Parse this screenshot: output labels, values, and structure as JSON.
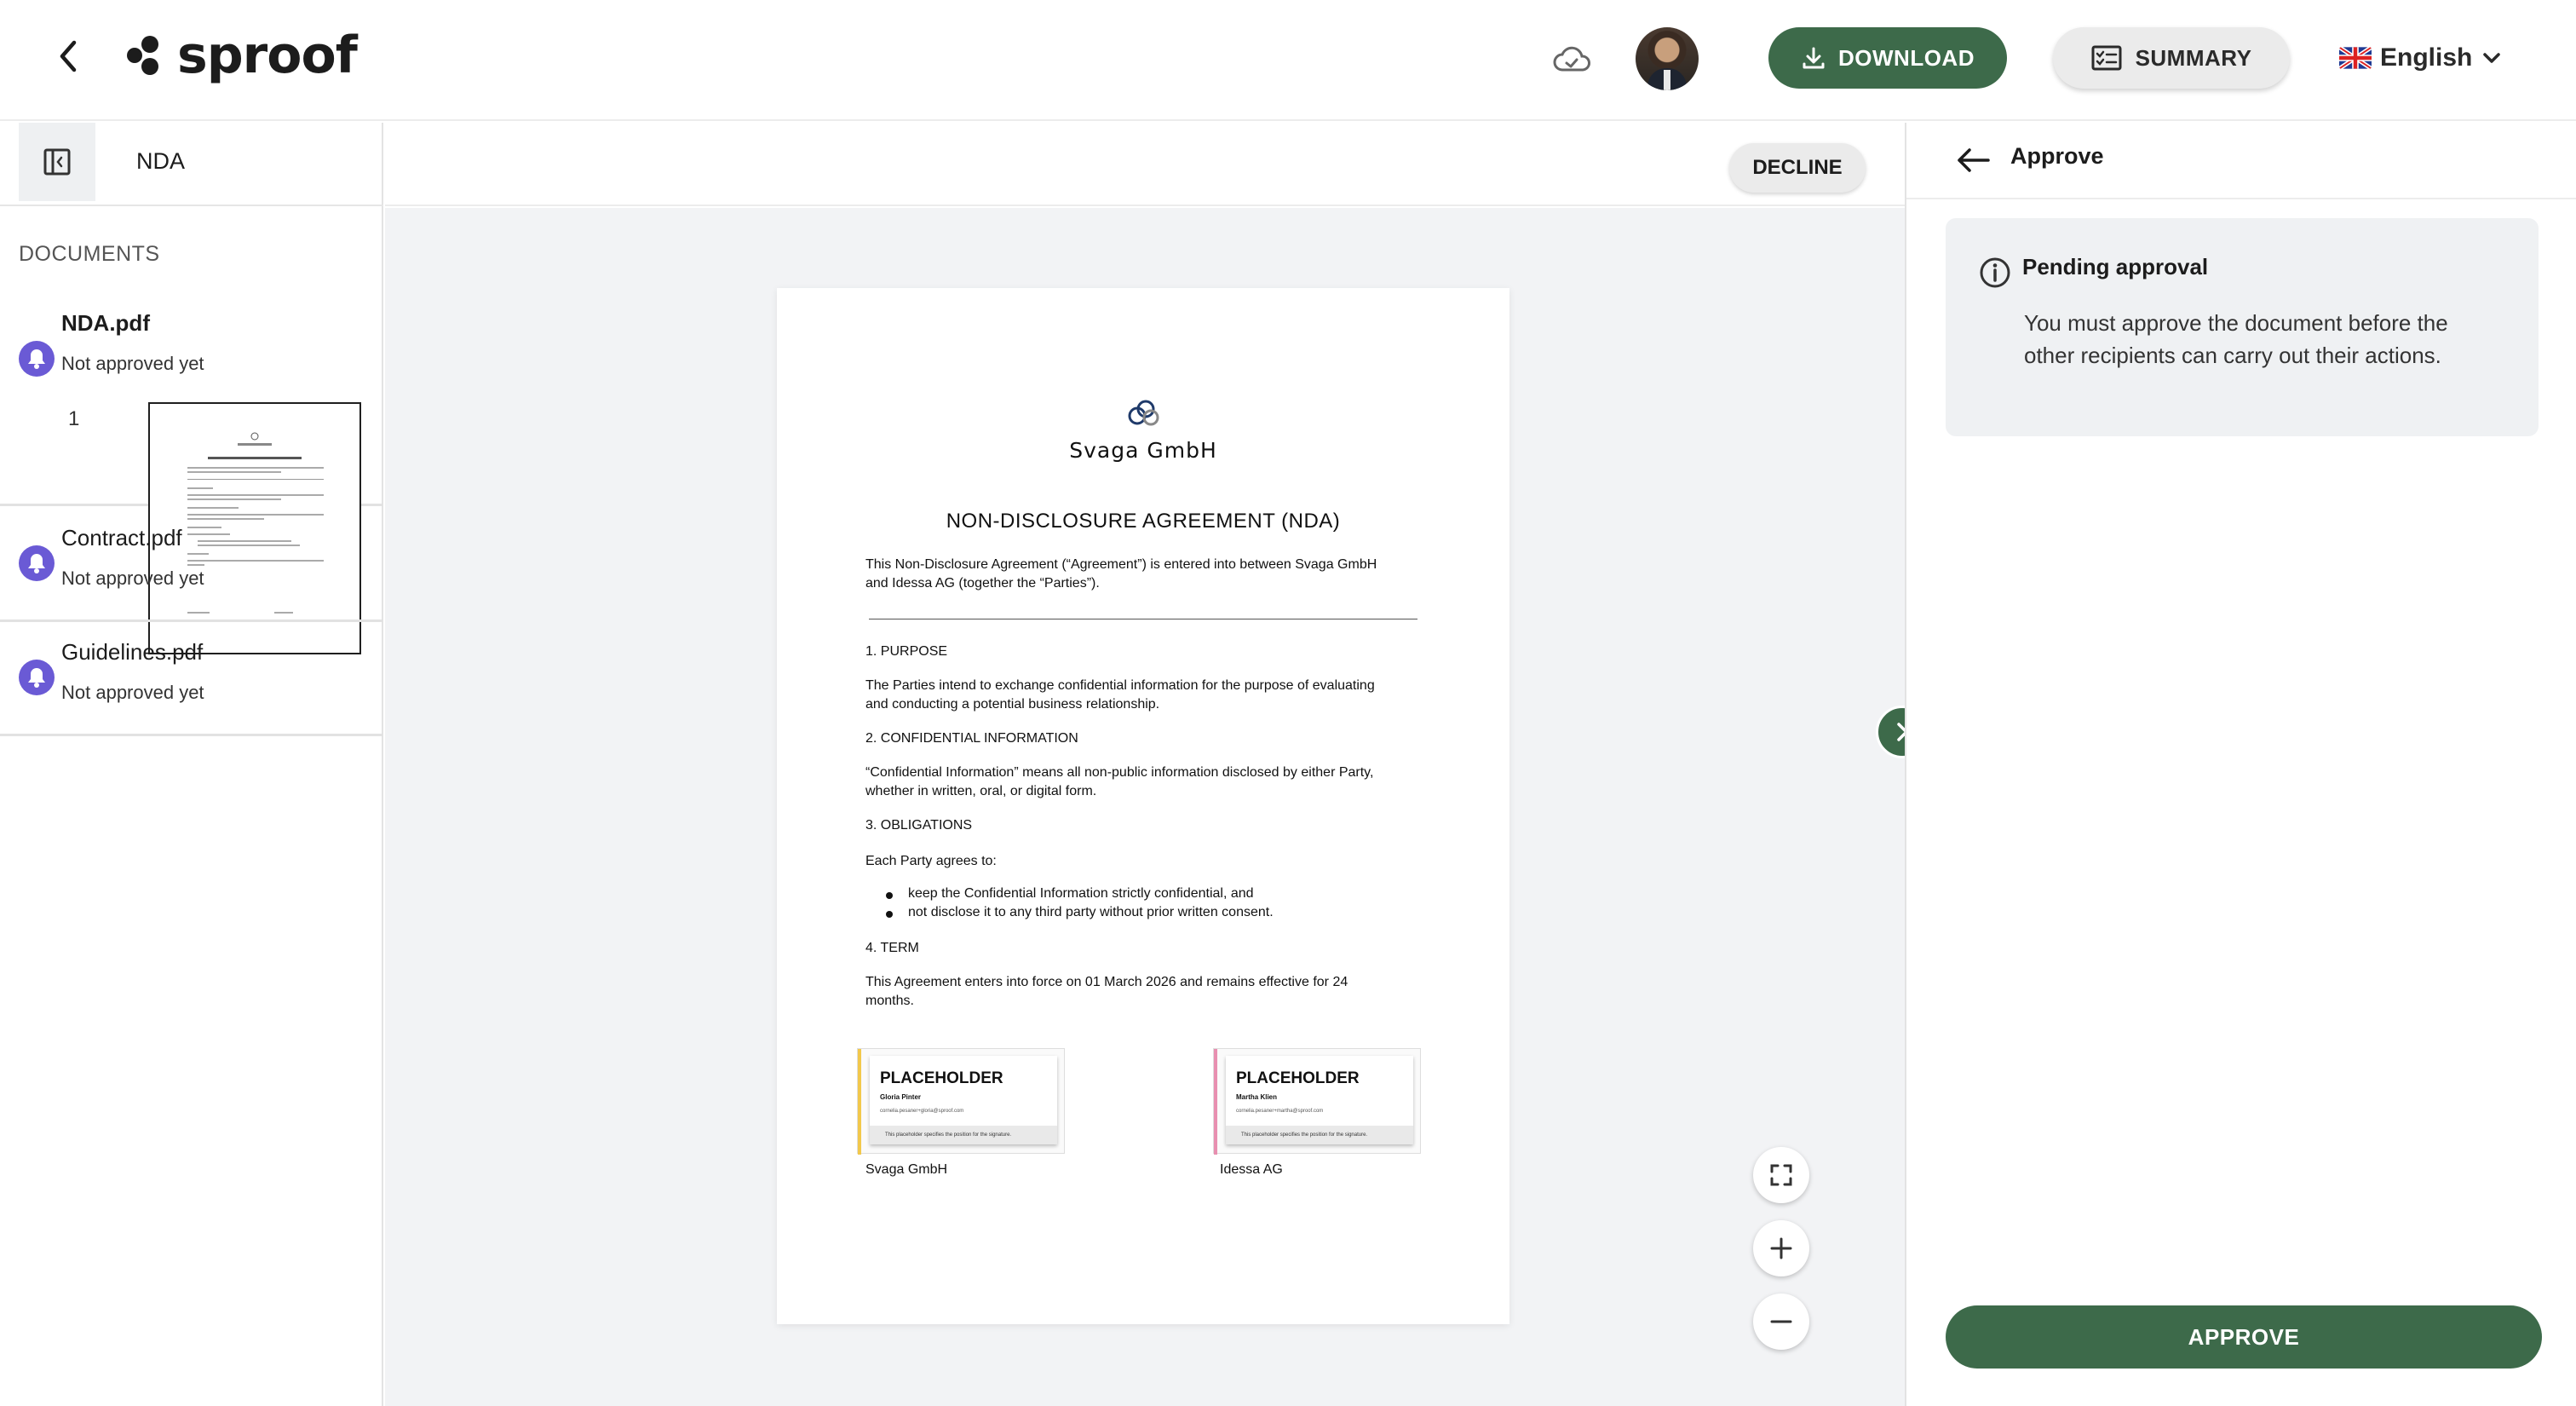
{
  "header": {
    "logo_text": "sproof",
    "download_label": "DOWNLOAD",
    "summary_label": "SUMMARY",
    "language": "English"
  },
  "toolbar": {
    "document_title": "NDA",
    "decline_label": "DECLINE"
  },
  "sidebar": {
    "section_label": "DOCUMENTS",
    "documents": [
      {
        "name": "NDA.pdf",
        "status": "Not approved yet",
        "active": true
      },
      {
        "name": "Contract.pdf",
        "status": "Not approved yet",
        "active": false
      },
      {
        "name": "Guidelines.pdf",
        "status": "Not approved yet",
        "active": false
      }
    ],
    "page_number": "1"
  },
  "document": {
    "company": "Svaga GmbH",
    "title": "NON-DISCLOSURE AGREEMENT (NDA)",
    "intro_1": "This Non-Disclosure Agreement (“Agreement”) is entered into between Svaga GmbH",
    "intro_2": "and Idessa AG (together the “Parties”).",
    "s1_head": "1. PURPOSE",
    "s1_text_1": "The Parties intend to exchange confidential information for the purpose of evaluating",
    "s1_text_2": "and conducting a potential business relationship.",
    "s2_head": "2. CONFIDENTIAL INFORMATION",
    "s2_text_1": "“Confidential Information” means all non-public information disclosed by either Party,",
    "s2_text_2": "whether in written, oral, or digital form.",
    "s3_head": "3. OBLIGATIONS",
    "s3_text": "Each Party agrees to:",
    "s3_bullet_1": "keep the Confidential Information strictly confidential, and",
    "s3_bullet_2": "not disclose it to any third party without prior written consent.",
    "s4_head": "4. TERM",
    "s4_text_1": "This Agreement enters into force on 01 March 2026 and remains effective for 24",
    "s4_text_2": "months.",
    "placeholders": [
      {
        "title": "PLACEHOLDER",
        "name": "Gloria Pinter",
        "email": "cornelia.pesaner+gloria@sproof.com",
        "note": "This placeholder specifies the position for the signature.",
        "party": "Svaga GmbH",
        "color": "#f2c84b"
      },
      {
        "title": "PLACEHOLDER",
        "name": "Martha Klien",
        "email": "cornelia.pesaner+martha@sproof.com",
        "note": "This placeholder specifies the position for the signature.",
        "party": "Idessa AG",
        "color": "#e88fb0"
      }
    ]
  },
  "panel": {
    "title": "Approve",
    "notice_title": "Pending approval",
    "notice_text": "You must approve the document before the other recipients can carry out their actions.",
    "approve_label": "APPROVE"
  },
  "colors": {
    "accent": "#3d6a4a",
    "bell": "#6a5ad5"
  }
}
